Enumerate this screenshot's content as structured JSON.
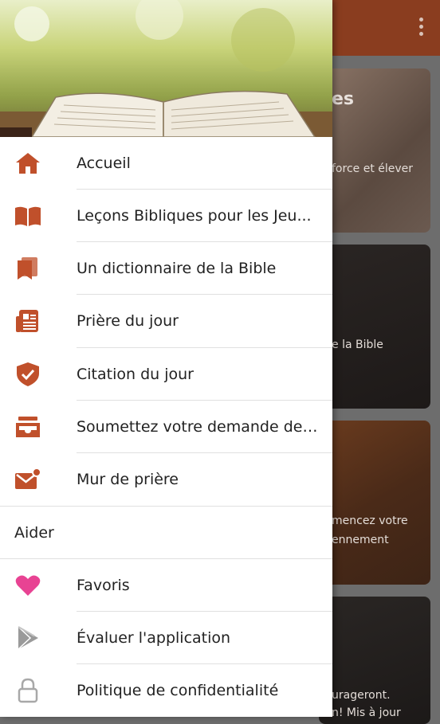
{
  "background": {
    "cards": [
      {
        "title": "es",
        "subtitle": "force et élever"
      },
      {
        "subtitle": "e la Bible"
      },
      {
        "line1": "mencez votre",
        "line2": "ennement"
      },
      {
        "line1": "urageront.",
        "line2": "n! Mis à jour"
      }
    ]
  },
  "drawer": {
    "items": [
      {
        "label": "Accueil",
        "icon": "home-icon"
      },
      {
        "label": "Leçons Bibliques pour les Jeu...",
        "icon": "open-book-icon"
      },
      {
        "label": "Un dictionnaire de la Bible",
        "icon": "bookmark-book-icon"
      },
      {
        "label": "Prière du jour",
        "icon": "newspaper-icon"
      },
      {
        "label": "Citation du jour",
        "icon": "shield-check-icon"
      },
      {
        "label": "Soumettez votre demande de ...",
        "icon": "inbox-icon"
      },
      {
        "label": "Mur de prière",
        "icon": "mail-notification-icon"
      }
    ],
    "section_title": "Aider",
    "help_items": [
      {
        "label": "Favoris",
        "icon": "heart-icon"
      },
      {
        "label": "Évaluer l'application",
        "icon": "play-store-icon"
      },
      {
        "label": "Politique de confidentialité",
        "icon": "lock-icon"
      }
    ]
  },
  "colors": {
    "accent": "#c0502b",
    "heart": "#e84393",
    "appbar": "#8a3d1f"
  }
}
